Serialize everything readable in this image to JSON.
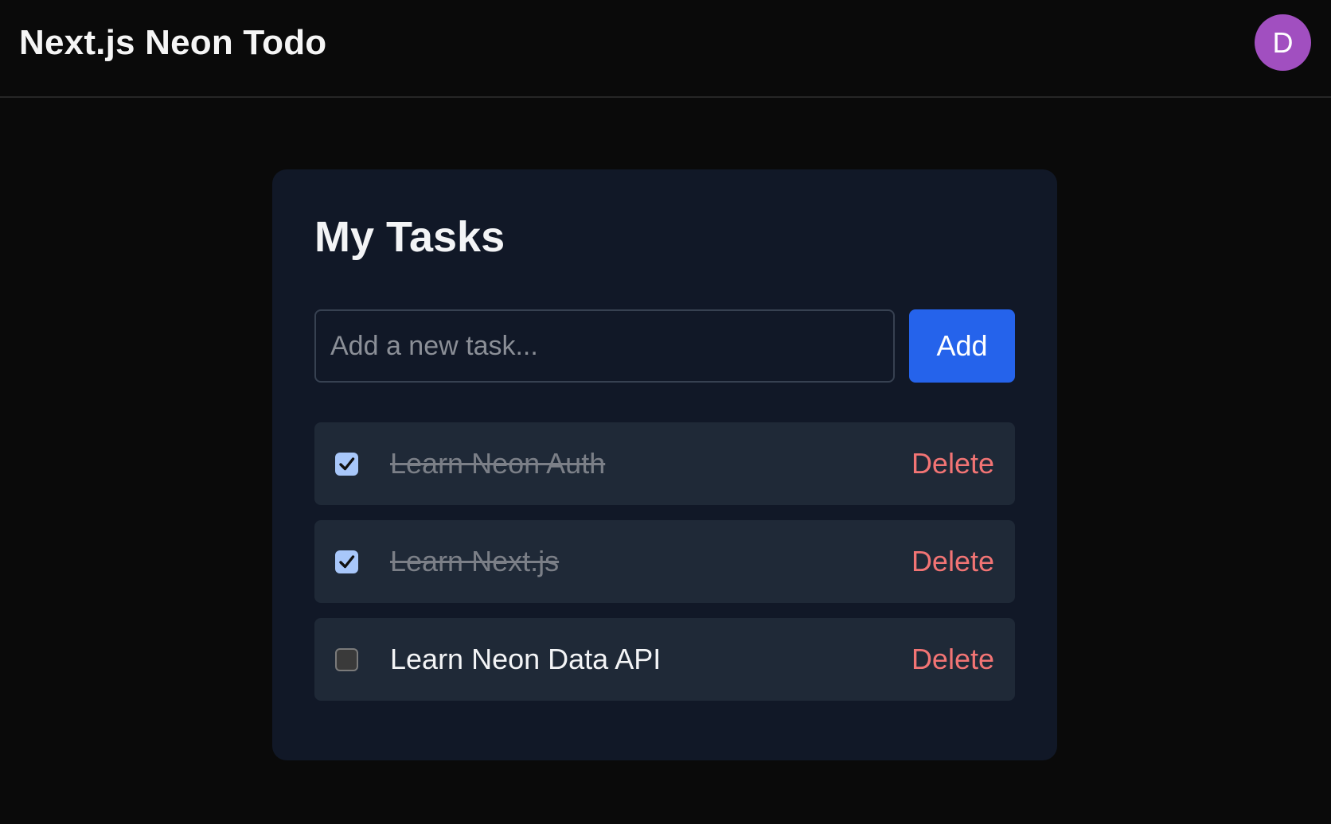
{
  "header": {
    "app_title": "Next.js Neon Todo",
    "avatar_initial": "D",
    "avatar_color": "#a14fc0"
  },
  "main": {
    "card_title": "My Tasks",
    "new_task_input": {
      "value": "",
      "placeholder": "Add a new task..."
    },
    "add_button_label": "Add",
    "tasks": [
      {
        "text": "Learn Neon Auth",
        "completed": true,
        "delete_label": "Delete"
      },
      {
        "text": "Learn Next.js",
        "completed": true,
        "delete_label": "Delete"
      },
      {
        "text": "Learn Neon Data API",
        "completed": false,
        "delete_label": "Delete"
      }
    ]
  },
  "colors": {
    "page_background": "#0a0a0a",
    "card_background": "#111827",
    "row_background": "#1f2937",
    "accent_blue": "#2563eb",
    "delete_red": "#f27474",
    "checkbox_checked": "#a8c7fa"
  }
}
